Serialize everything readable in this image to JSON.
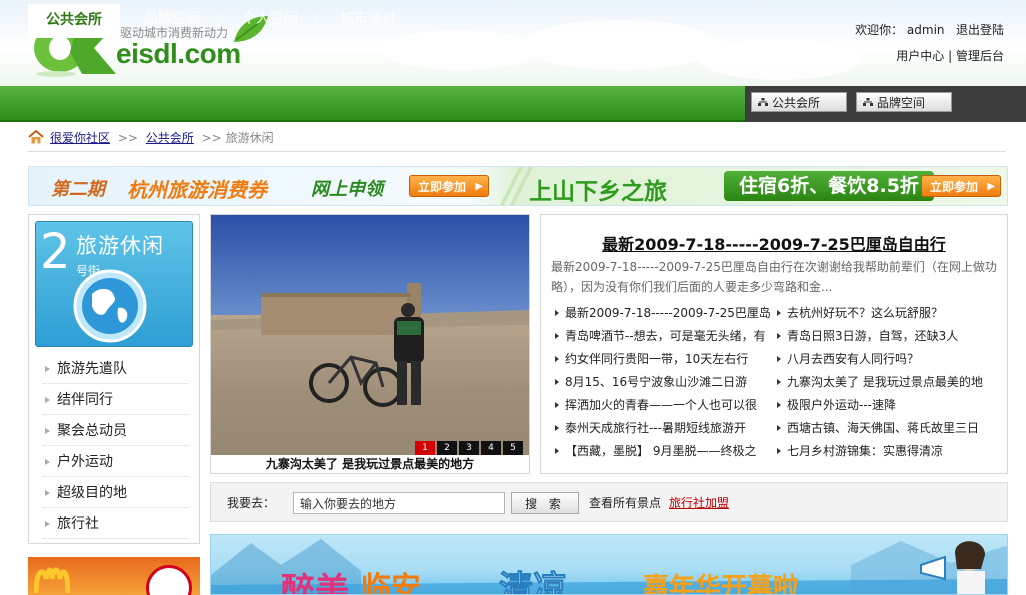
{
  "header": {
    "logo_text": "eisdl.com",
    "logo_tagline": "驱动城市消费新动力",
    "welcome": "欢迎你：",
    "username": "admin",
    "logout": "退出登陆",
    "user_center": "用户中心",
    "admin_panel": "管理后台"
  },
  "nav": {
    "items": [
      {
        "label": "公共会所"
      },
      {
        "label": "品牌空间"
      },
      {
        "label": "个人空间"
      },
      {
        "label": "城市派对"
      }
    ],
    "right_tags": [
      {
        "label": "公共会所"
      },
      {
        "label": "品牌空间"
      }
    ]
  },
  "breadcrumb": {
    "home": "很爱你社区",
    "sep1": ">>",
    "section": "公共会所",
    "sep2": ">>",
    "current": "旅游休闲"
  },
  "banner": {
    "issue": "第二期",
    "title": "杭州旅游消费券",
    "subtitle": "网上申领",
    "button1": "立即参加",
    "slogan": "上山下乡之旅",
    "promo": "住宿6折、餐饮8.5折",
    "button2": "立即参加"
  },
  "category": {
    "number": "2",
    "title": "旅游休闲",
    "street": "号街",
    "items": [
      {
        "label": "旅游先遣队"
      },
      {
        "label": "结伴同行"
      },
      {
        "label": "聚会总动员"
      },
      {
        "label": "户外运动"
      },
      {
        "label": "超级目的地"
      },
      {
        "label": "旅行社"
      }
    ]
  },
  "photo": {
    "caption": "九寨沟太美了 是我玩过景点最美的地方",
    "slides": [
      "1",
      "2",
      "3",
      "4",
      "5"
    ],
    "active_slide": 1
  },
  "news": {
    "headline": "最新2009-7-18-----2009-7-25巴厘岛自由行",
    "description": "最新2009-7-18-----2009-7-25巴厘岛自由行在次谢谢给我帮助前辈们（在网上做功略），因为没有你们我们后面的人要走多少弯路和金...",
    "left": [
      "最新2009-7-18-----2009-7-25巴厘岛",
      "青岛啤酒节--想去，可是毫无头绪，有",
      "约女伴同行贵阳一带，10天左右行",
      "8月15、16号宁波象山沙滩二日游",
      "挥洒加火的青春——一个人也可以很",
      "泰州天成旅行社---暑期短线旅游开",
      "【西藏，墨脱】 9月墨脱——终极之"
    ],
    "right": [
      "去杭州好玩不？这么玩舒服？",
      "青岛日照3日游，自驾，还缺3人",
      "八月去西安有人同行吗？",
      "九寨沟太美了 是我玩过景点最美的地",
      "极限户外运动---速降",
      "西塘古镇、海天佛国、蒋氏故里三日",
      "七月乡村游锦集：实惠得清凉"
    ]
  },
  "search": {
    "label": "我要去：",
    "value": "输入你要去的地方",
    "button": "搜 索",
    "all_spots": "查看所有景点",
    "agency_join": "旅行社加盟"
  },
  "bottom_banner": {
    "text1": "醉美",
    "text2": "临安",
    "text3": "清凉",
    "text4": "嘉年华开幕啦"
  },
  "colors": {
    "nav_green": "#3a9a22",
    "accent_orange": "#f07c10",
    "link_blue": "#1a1a8c",
    "link_red": "#c00000"
  }
}
